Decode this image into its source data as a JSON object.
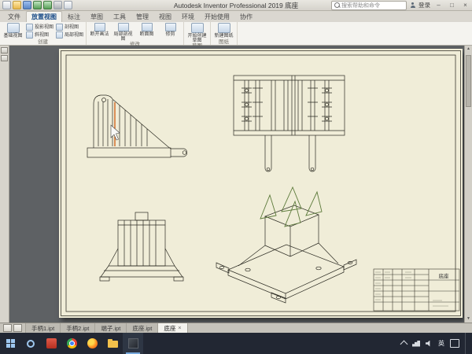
{
  "colors": {
    "sheet": "#f0edd8",
    "canvas": "#5e6164",
    "taskbar": "#222733",
    "highlight": "#c94f00",
    "fin": "#5c7a3a",
    "accent": "#2f6fb0"
  },
  "titlebar": {
    "title": "Autodesk Inventor Professional 2019 底座",
    "search_placeholder": "搜索帮助和命令",
    "signin": "登录",
    "min": "–",
    "max": "□",
    "close": "×"
  },
  "ribbon": {
    "tabs": [
      {
        "label": "文件"
      },
      {
        "label": "放置视图"
      },
      {
        "label": "标注"
      },
      {
        "label": "草图"
      },
      {
        "label": "工具"
      },
      {
        "label": "管理"
      },
      {
        "label": "视图"
      },
      {
        "label": "环境"
      },
      {
        "label": "开始使用"
      },
      {
        "label": "协作"
      }
    ],
    "groups": [
      {
        "label": "创建",
        "buttons": [
          {
            "label": "基础视图"
          },
          {
            "label": "投影视图"
          },
          {
            "label": "斜视图"
          },
          {
            "label": "剖视图"
          },
          {
            "label": "局部视图"
          }
        ]
      },
      {
        "label": "修改",
        "buttons": [
          {
            "label": "断开画法"
          },
          {
            "label": "局部剖视图"
          },
          {
            "label": "断面图"
          },
          {
            "label": "修剪"
          }
        ]
      },
      {
        "label": "草图",
        "buttons": [
          {
            "label": "开始创建草图"
          }
        ]
      },
      {
        "label": "图纸",
        "buttons": [
          {
            "label": "新建图纸"
          }
        ]
      }
    ]
  },
  "sheet": {
    "titleblock": {
      "part_name": "底座"
    }
  },
  "docbar": {
    "tabs": [
      {
        "label": "手柄1.ipt"
      },
      {
        "label": "手柄2.ipt"
      },
      {
        "label": "端子.ipt"
      },
      {
        "label": "底座.ipt"
      },
      {
        "label": "底座",
        "close": "×"
      }
    ]
  },
  "taskbar": {
    "lang": "英"
  }
}
